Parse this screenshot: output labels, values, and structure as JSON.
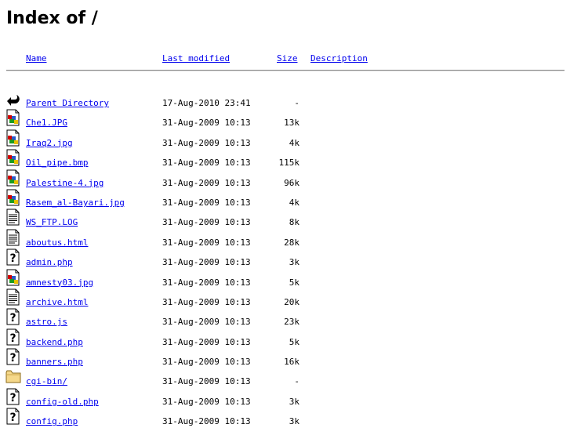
{
  "page": {
    "title": "Index of /"
  },
  "header": {
    "name_label": "Name",
    "modified_label": "Last modified",
    "size_label": "Size",
    "description_label": "Description"
  },
  "entries": [
    {
      "icon": "back-icon",
      "name": "Parent Directory",
      "modified": "17-Aug-2010 23:41",
      "size": "-"
    },
    {
      "icon": "image-icon",
      "name": "Che1.JPG",
      "modified": "31-Aug-2009 10:13",
      "size": "13k"
    },
    {
      "icon": "image-icon",
      "name": "Iraq2.jpg",
      "modified": "31-Aug-2009 10:13",
      "size": "4k"
    },
    {
      "icon": "image-icon",
      "name": "Oil_pipe.bmp",
      "modified": "31-Aug-2009 10:13",
      "size": "115k"
    },
    {
      "icon": "image-icon",
      "name": "Palestine-4.jpg",
      "modified": "31-Aug-2009 10:13",
      "size": "96k"
    },
    {
      "icon": "image-icon",
      "name": "Rasem_al-Bayari.jpg",
      "modified": "31-Aug-2009 10:13",
      "size": "4k"
    },
    {
      "icon": "text-icon",
      "name": "WS_FTP.LOG",
      "modified": "31-Aug-2009 10:13",
      "size": "8k"
    },
    {
      "icon": "text-icon",
      "name": "aboutus.html",
      "modified": "31-Aug-2009 10:13",
      "size": "28k"
    },
    {
      "icon": "unknown-icon",
      "name": "admin.php",
      "modified": "31-Aug-2009 10:13",
      "size": "3k"
    },
    {
      "icon": "image-icon",
      "name": "amnesty03.jpg",
      "modified": "31-Aug-2009 10:13",
      "size": "5k"
    },
    {
      "icon": "text-icon",
      "name": "archive.html",
      "modified": "31-Aug-2009 10:13",
      "size": "20k"
    },
    {
      "icon": "unknown-icon",
      "name": "astro.js",
      "modified": "31-Aug-2009 10:13",
      "size": "23k"
    },
    {
      "icon": "unknown-icon",
      "name": "backend.php",
      "modified": "31-Aug-2009 10:13",
      "size": "5k"
    },
    {
      "icon": "unknown-icon",
      "name": "banners.php",
      "modified": "31-Aug-2009 10:13",
      "size": "16k"
    },
    {
      "icon": "folder-icon",
      "name": "cgi-bin/",
      "modified": "31-Aug-2009 10:13",
      "size": "-"
    },
    {
      "icon": "unknown-icon",
      "name": "config-old.php",
      "modified": "31-Aug-2009 10:13",
      "size": "3k"
    },
    {
      "icon": "unknown-icon",
      "name": "config.php",
      "modified": "31-Aug-2009 10:13",
      "size": "3k"
    }
  ]
}
